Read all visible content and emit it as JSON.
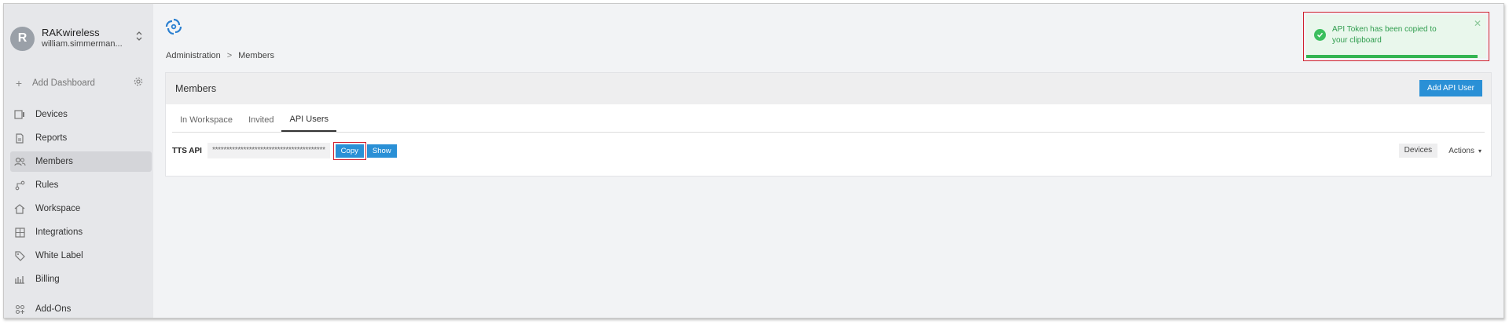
{
  "account": {
    "initial": "R",
    "name": "RAKwireless",
    "email": "william.simmerman..."
  },
  "sidebar": {
    "add_dashboard": "Add Dashboard",
    "items": [
      {
        "label": "Devices",
        "icon": "devices-icon",
        "active": false
      },
      {
        "label": "Reports",
        "icon": "reports-icon",
        "active": false
      },
      {
        "label": "Members",
        "icon": "members-icon",
        "active": true
      },
      {
        "label": "Rules",
        "icon": "rules-icon",
        "active": false
      },
      {
        "label": "Workspace",
        "icon": "workspace-icon",
        "active": false
      },
      {
        "label": "Integrations",
        "icon": "integrations-icon",
        "active": false
      },
      {
        "label": "White Label",
        "icon": "tag-icon",
        "active": false
      },
      {
        "label": "Billing",
        "icon": "billing-icon",
        "active": false
      },
      {
        "label": "Add-Ons",
        "icon": "addons-icon",
        "active": false
      }
    ]
  },
  "breadcrumb": {
    "parent": "Administration",
    "separator": ">",
    "current": "Members"
  },
  "card": {
    "title": "Members",
    "add_button": "Add API User",
    "tabs": [
      {
        "label": "In Workspace",
        "active": false
      },
      {
        "label": "Invited",
        "active": false
      },
      {
        "label": "API Users",
        "active": true
      }
    ]
  },
  "api_user": {
    "name": "TTS API",
    "token_masked": "****************************************",
    "copy_label": "Copy",
    "show_label": "Show",
    "devices_label": "Devices",
    "actions_label": "Actions"
  },
  "toast": {
    "message": "API Token has been copied to your clipboard",
    "progress_fraction": 0.95
  },
  "colors": {
    "primary": "#2a90d6",
    "success": "#3bbf5e",
    "highlight": "#d0202e"
  }
}
